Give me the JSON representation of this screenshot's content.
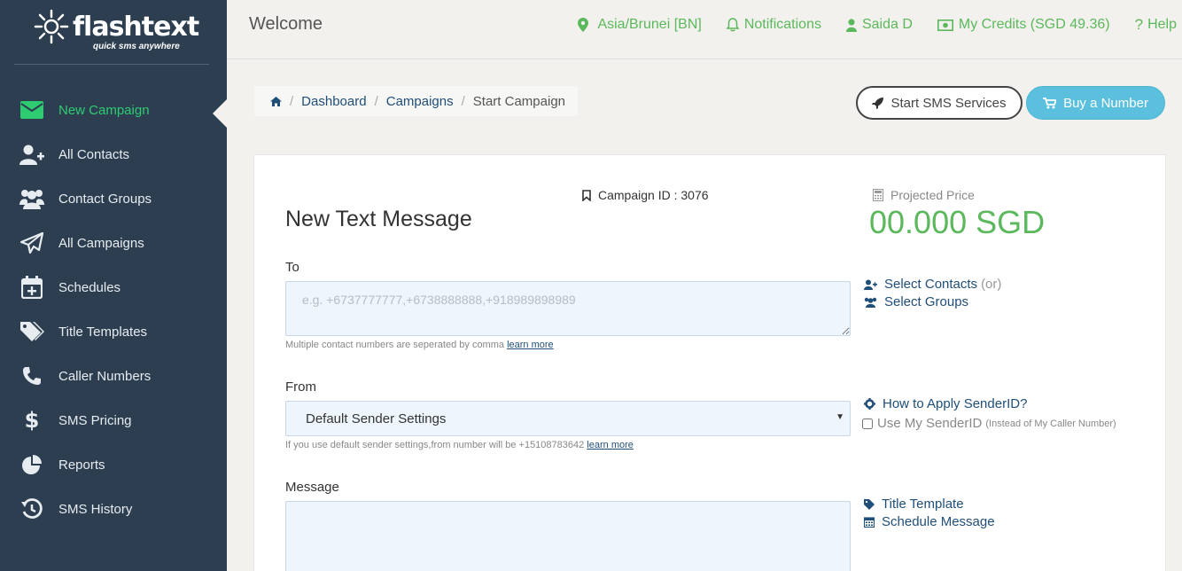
{
  "brand": {
    "name": "flashtext",
    "tagline": "quick sms anywhere",
    "accent": "#2ecc71",
    "sidebar_bg": "#2c3e50"
  },
  "sidebar": {
    "items": [
      {
        "label": "New Campaign",
        "icon": "envelope-icon",
        "active": true
      },
      {
        "label": "All Contacts",
        "icon": "user-plus-icon"
      },
      {
        "label": "Contact Groups",
        "icon": "users-icon"
      },
      {
        "label": "All Campaigns",
        "icon": "paper-plane-icon"
      },
      {
        "label": "Schedules",
        "icon": "calendar-plus-icon"
      },
      {
        "label": "Title Templates",
        "icon": "tags-icon"
      },
      {
        "label": "Caller Numbers",
        "icon": "phone-icon"
      },
      {
        "label": "SMS Pricing",
        "icon": "dollar-icon"
      },
      {
        "label": "Reports",
        "icon": "pie-chart-icon"
      },
      {
        "label": "SMS History",
        "icon": "history-icon"
      }
    ]
  },
  "header": {
    "welcome": "Welcome",
    "timezone": "Asia/Brunei [BN]",
    "notifications": "Notifications",
    "user": "Saida D",
    "credits": "My Credits (SGD 49.36)",
    "help": "Help"
  },
  "breadcrumb": {
    "dashboard": "Dashboard",
    "campaigns": "Campaigns",
    "current": "Start Campaign"
  },
  "actions": {
    "start_sms": "Start SMS Services",
    "buy_number": "Buy a Number"
  },
  "form": {
    "campaign_id": "Campaign ID : 3076",
    "title": "New Text Message",
    "projected_label": "Projected Price",
    "projected_value": "00.000 SGD",
    "to_label": "To",
    "to_placeholder": "e.g. +6737777777,+6738888888,+918989898989",
    "to_hint": "Multiple contact numbers are seperated by comma",
    "learn_more": "learn more",
    "select_contacts": "Select Contacts",
    "or": "(or)",
    "select_groups": "Select Groups",
    "from_label": "From",
    "from_value": "Default Sender Settings",
    "from_hint": "If you use default sender settings,from number will be +15108783642",
    "how_apply": "How to Apply SenderID?",
    "use_sender": "Use My SenderID",
    "use_sender_note": "(Instead of My Caller Number)",
    "message_label": "Message",
    "title_template": "Title Template",
    "schedule_message": "Schedule Message"
  }
}
